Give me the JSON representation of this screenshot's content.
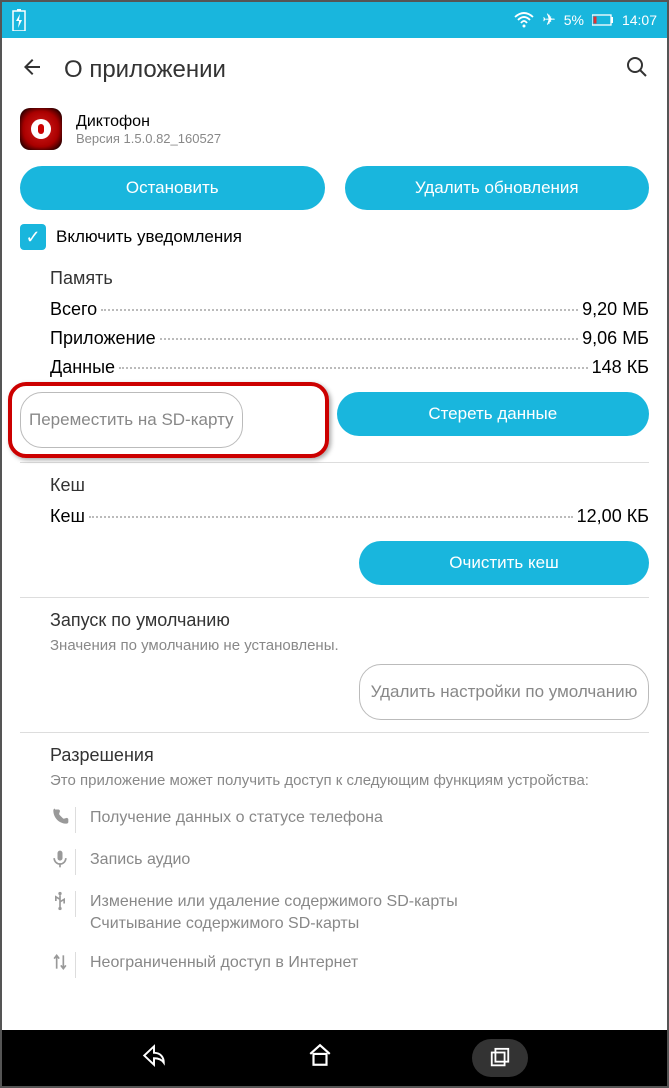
{
  "status": {
    "battery_percent": "5%",
    "time": "14:07"
  },
  "header": {
    "title": "О приложении"
  },
  "app": {
    "name": "Диктофон",
    "version": "Версия 1.5.0.82_160527"
  },
  "buttons": {
    "stop": "Остановить",
    "delete_updates": "Удалить обновления",
    "move_sd": "Переместить на SD-карту",
    "clear_data": "Стереть данные",
    "clear_cache": "Очистить кеш",
    "delete_defaults": "Удалить настройки по умолчанию"
  },
  "checkbox": {
    "enable_notifications": "Включить уведомления"
  },
  "memory": {
    "title": "Память",
    "total_label": "Всего",
    "total_value": "9,20 МБ",
    "app_label": "Приложение",
    "app_value": "9,06 МБ",
    "data_label": "Данные",
    "data_value": "148 КБ"
  },
  "cache": {
    "title": "Кеш",
    "label": "Кеш",
    "value": "12,00 КБ"
  },
  "defaults": {
    "title": "Запуск по умолчанию",
    "subtitle": "Значения по умолчанию не установлены."
  },
  "permissions": {
    "title": "Разрешения",
    "subtitle": "Это приложение может получить доступ к следующим функциям устройства:",
    "items": [
      {
        "icon": "phone",
        "text": "Получение данных о статусе телефона"
      },
      {
        "icon": "mic",
        "text": "Запись аудио"
      },
      {
        "icon": "usb",
        "text": "Изменение или удаление содержимого SD-карты\nСчитывание содержимого SD-карты"
      },
      {
        "icon": "network",
        "text": "Неограниченный доступ в Интернет"
      }
    ]
  }
}
